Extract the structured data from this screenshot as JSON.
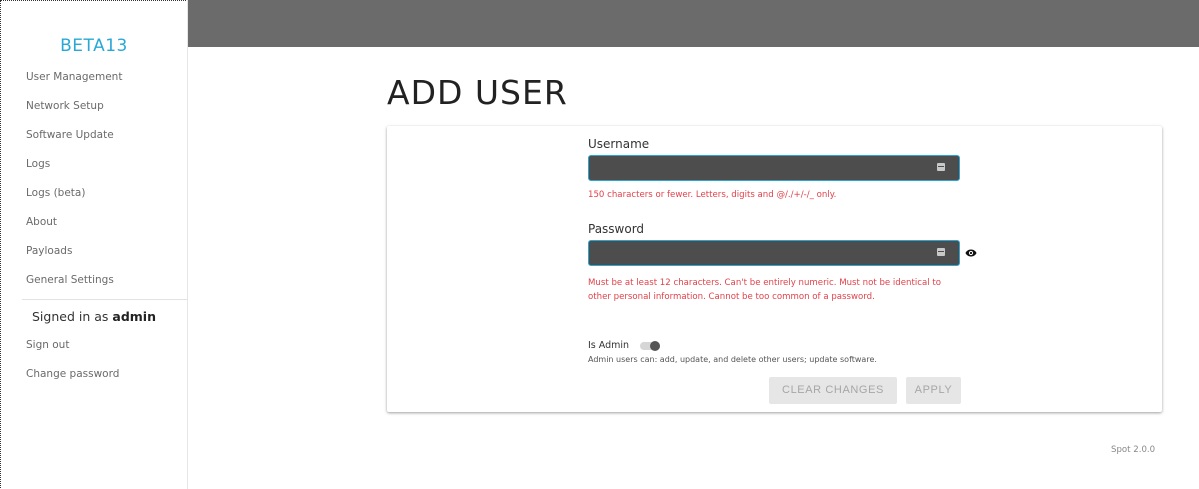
{
  "sidebar": {
    "brand": "BETA13",
    "items": [
      {
        "label": "User Management"
      },
      {
        "label": "Network Setup"
      },
      {
        "label": "Software Update"
      },
      {
        "label": "Logs"
      },
      {
        "label": "Logs (beta)"
      },
      {
        "label": "About"
      },
      {
        "label": "Payloads"
      },
      {
        "label": "General Settings"
      }
    ],
    "signed_in_prefix": "Signed in as",
    "signed_in_user": "admin",
    "account_items": [
      {
        "label": "Sign out"
      },
      {
        "label": "Change password"
      }
    ]
  },
  "main": {
    "title": "ADD USER",
    "form": {
      "username_label": "Username",
      "username_value": "",
      "username_help": "150 characters or fewer. Letters, digits and @/./+/-/_ only.",
      "password_label": "Password",
      "password_value": "",
      "password_help": "Must be at least 12 characters. Can't be entirely numeric. Must not be identical to other personal information. Cannot be too common of a password.",
      "is_admin_label": "Is Admin",
      "is_admin_on": false,
      "admin_help": "Admin users can: add, update, and delete other users; update software.",
      "clear_button": "CLEAR CHANGES",
      "apply_button": "APPLY"
    }
  },
  "footer": {
    "version": "Spot 2.0.0"
  },
  "colors": {
    "brand": "#29a8d6",
    "topbar": "#6b6b6b",
    "input_bg": "#4d4d4d",
    "input_border": "#2aa6d3",
    "error_text": "#e0424a"
  },
  "icons": {
    "input_icon": "password-manager-icon",
    "eye_icon": "eye-icon"
  }
}
